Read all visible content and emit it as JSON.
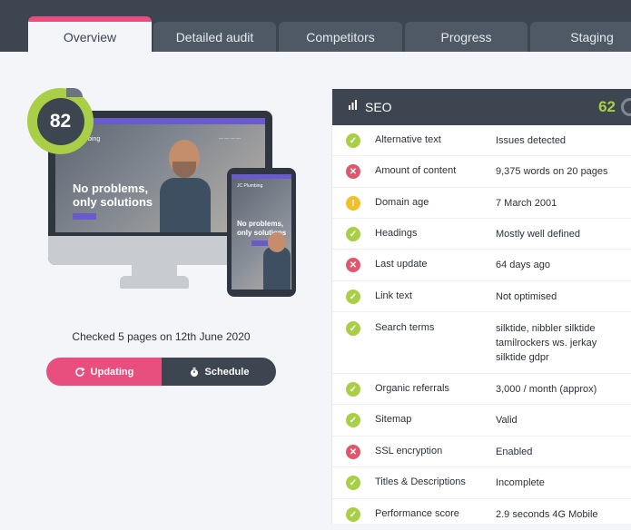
{
  "tabs": [
    {
      "label": "Overview",
      "active": true
    },
    {
      "label": "Detailed audit"
    },
    {
      "label": "Competitors"
    },
    {
      "label": "Progress"
    },
    {
      "label": "Staging"
    }
  ],
  "score": {
    "value": "82",
    "color": "#a8cf45"
  },
  "preview": {
    "headline_line1": "No problems,",
    "headline_line2": "only solutions",
    "brand": "bing",
    "phone_brand": "JC Plumbing"
  },
  "checked_text": "Checked 5 pages on 12th June 2020",
  "buttons": {
    "updating": "Updating",
    "schedule": "Schedule"
  },
  "panel": {
    "title": "SEO",
    "score": "62",
    "rows": [
      {
        "label": "Alternative text",
        "value": "Issues detected",
        "status": "ok",
        "icon": "check-icon"
      },
      {
        "label": "Amount of content",
        "value": "9,375 words on 20 pages",
        "status": "bad",
        "icon": "x-icon"
      },
      {
        "label": "Domain age",
        "value": "7 March 2001",
        "status": "warn",
        "icon": "warning-icon"
      },
      {
        "label": "Headings",
        "value": "Mostly well defined",
        "status": "ok",
        "icon": "check-icon"
      },
      {
        "label": "Last update",
        "value": "64 days ago",
        "status": "bad",
        "icon": "x-icon"
      },
      {
        "label": "Link text",
        "value": "Not optimised",
        "status": "ok",
        "icon": "check-icon"
      },
      {
        "label": "Search terms",
        "value": "silktide, nibbler silktide tamilrockers ws. jerkay silktide gdpr",
        "status": "ok",
        "icon": "check-icon"
      },
      {
        "label": "Organic referrals",
        "value": "3,000 / month (approx)",
        "status": "ok",
        "icon": "check-icon"
      },
      {
        "label": "Sitemap",
        "value": "Valid",
        "status": "ok",
        "icon": "check-icon"
      },
      {
        "label": "SSL encryption",
        "value": "Enabled",
        "status": "bad",
        "icon": "x-icon"
      },
      {
        "label": "Titles & Descriptions",
        "value": "Incomplete",
        "status": "ok",
        "icon": "check-icon"
      },
      {
        "label": "Performance score",
        "value": "2.9 seconds  4G Mobile",
        "status": "ok",
        "icon": "check-icon"
      }
    ]
  }
}
